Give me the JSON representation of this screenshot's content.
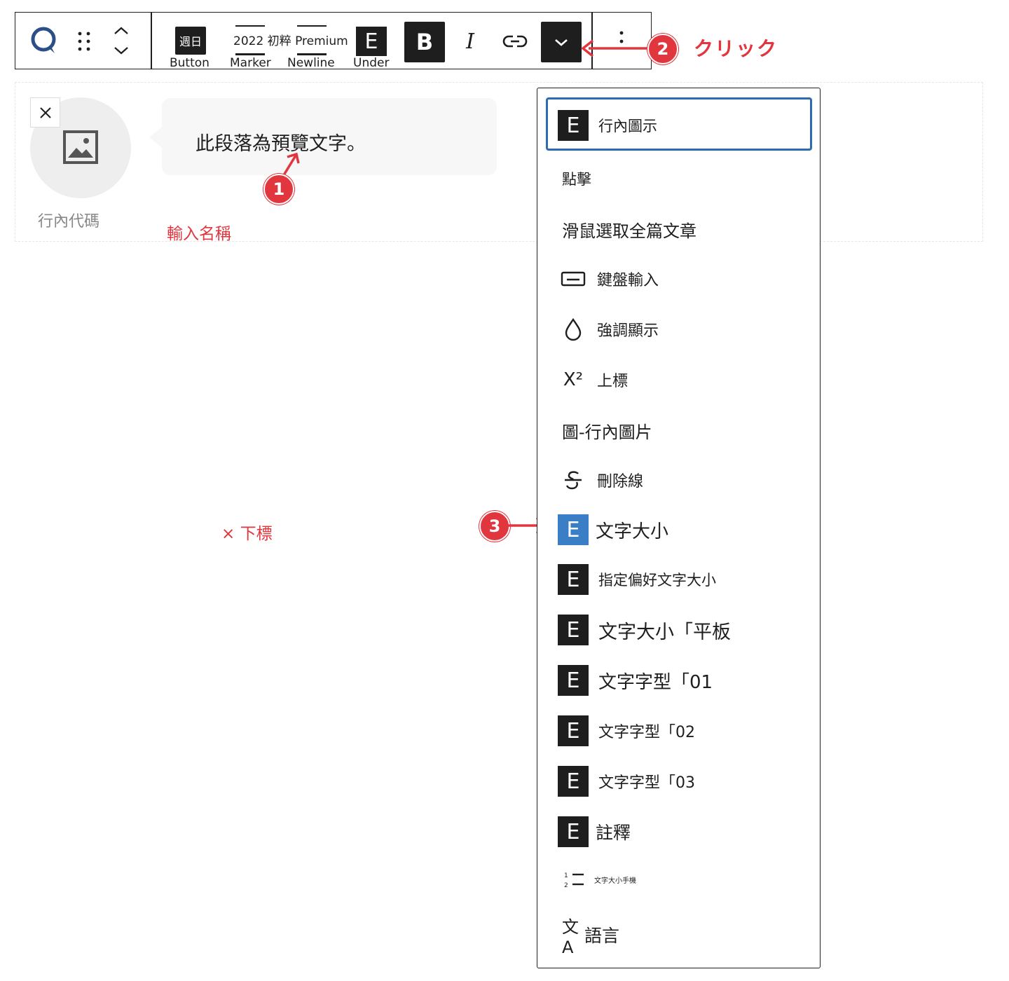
{
  "toolbar": {
    "buttons": {
      "button_icon_text": "週日",
      "button_label": "Button",
      "marker_text": "2022 初粹 Premium",
      "marker_label": "Marker",
      "newline_label": "Newline",
      "under_box_text": "E",
      "under_label": "Under",
      "bold_text": "B",
      "italic_text": "I"
    }
  },
  "block": {
    "avatar_name": "行內代碼",
    "bubble_text": "此段落為預覽文字。"
  },
  "annotations": {
    "click_text": "クリック",
    "step1": "1",
    "step2": "2",
    "step3": "3",
    "input_name": "輸入名稱",
    "subscript_removed": "× 下標"
  },
  "dropdown": {
    "items": [
      {
        "box": "E",
        "label": "行內圖示"
      },
      {
        "label": "點擊"
      },
      {
        "label": "滑鼠選取全篇文章"
      },
      {
        "label": "鍵盤輸入"
      },
      {
        "label": "強調顯示"
      },
      {
        "label": "上標"
      },
      {
        "label": "圖-行內圖片"
      },
      {
        "label": "刪除線"
      },
      {
        "box": "E",
        "label": "文字大小"
      },
      {
        "box": "E",
        "label": "指定偏好文字大小"
      },
      {
        "box": "E",
        "label": "文字大小「平板"
      },
      {
        "box": "E",
        "label": "文字字型「01"
      },
      {
        "box": "E",
        "label": "文字字型「02"
      },
      {
        "box": "E",
        "label": "文字字型「03"
      },
      {
        "box": "E",
        "label": "註釋"
      },
      {
        "label": "文字大小手機"
      },
      {
        "label": "語言"
      }
    ],
    "superscript_icon_text": "X²",
    "language_icon_text": "文A"
  },
  "colors": {
    "accent_red": "#e2363f",
    "highlight_blue": "#3a7fc6",
    "focus_ring": "#2c6cb3",
    "dark": "#1e1e1e"
  }
}
